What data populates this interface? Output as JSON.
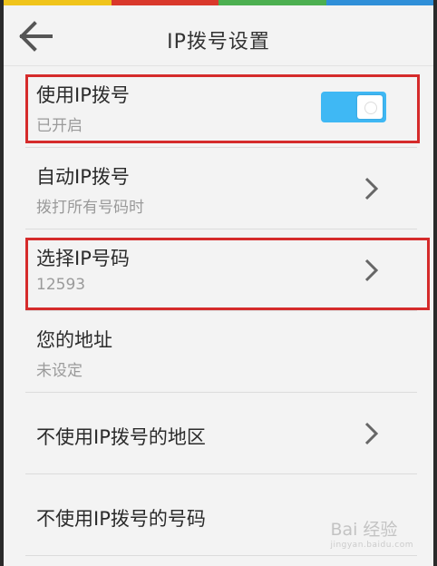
{
  "status_colors": [
    "#f0c41b",
    "#d9382b",
    "#4caf50",
    "#2f8fd8"
  ],
  "header": {
    "title": "IP拨号设置",
    "back_icon": "arrow-left-icon"
  },
  "items": [
    {
      "label": "使用IP拨号",
      "sub": "已开启",
      "control": "toggle",
      "toggle_on": true
    },
    {
      "label": "自动IP拨号",
      "sub": "拨打所有号码时",
      "control": "chevron"
    },
    {
      "label": "选择IP号码",
      "sub": "12593",
      "control": "chevron"
    },
    {
      "label": "您的地址",
      "sub": "未设定",
      "control": "none"
    },
    {
      "label": "不使用IP拨号的地区",
      "control": "chevron"
    },
    {
      "label": "不使用IP拨号的号码",
      "control": "none"
    }
  ],
  "colors": {
    "accent": "#3fb8f4",
    "highlight": "#d52b2b"
  },
  "watermark": {
    "text": "Bai 经验",
    "url": "jingyan.baidu.com"
  }
}
